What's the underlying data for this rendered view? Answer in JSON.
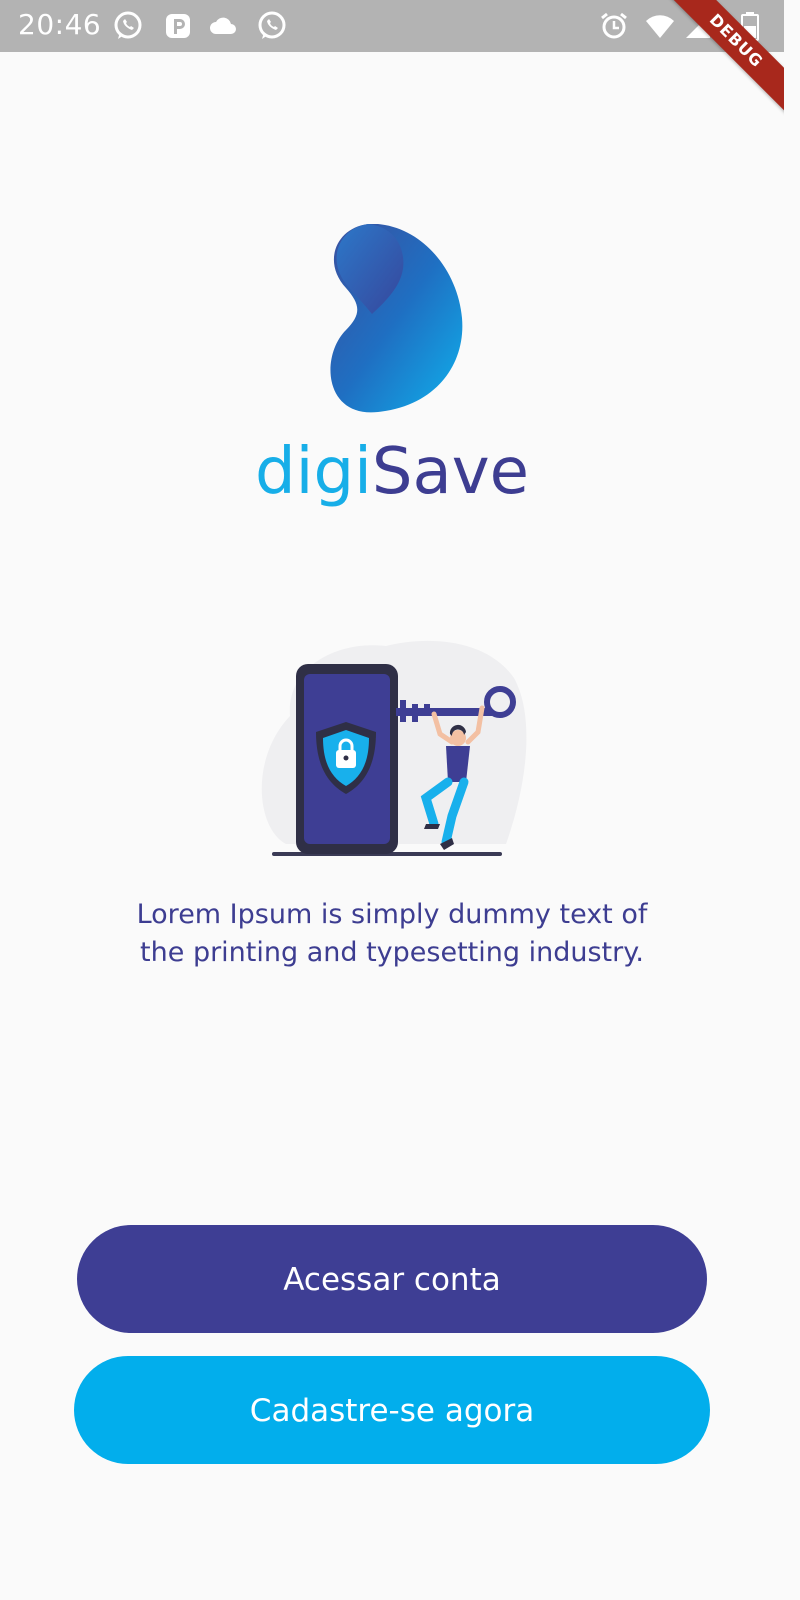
{
  "status_bar": {
    "time": "20:46",
    "left_icons": [
      "whatsapp-icon",
      "parking-icon",
      "cloud-icon",
      "whatsapp-icon"
    ],
    "right_icons": [
      "alarm-icon",
      "wifi-icon",
      "signal-icon",
      "battery-icon"
    ]
  },
  "debug_banner": "DEBUG",
  "logo": {
    "word_part1": "digi",
    "word_part2": "Save",
    "colors": {
      "digi": "#17aee8",
      "save": "#3d3d91"
    }
  },
  "illustration": {
    "description_icon": "security-key-phone-illustration"
  },
  "description": "Lorem Ipsum is simply dummy text of the printing and typesetting industry.",
  "buttons": {
    "login_label": "Acessar conta",
    "signup_label": "Cadastre-se agora"
  },
  "colors": {
    "primary": "#3e3e94",
    "accent": "#02aeec",
    "background": "#fafafa",
    "status_bar": "#b3b3b3"
  }
}
